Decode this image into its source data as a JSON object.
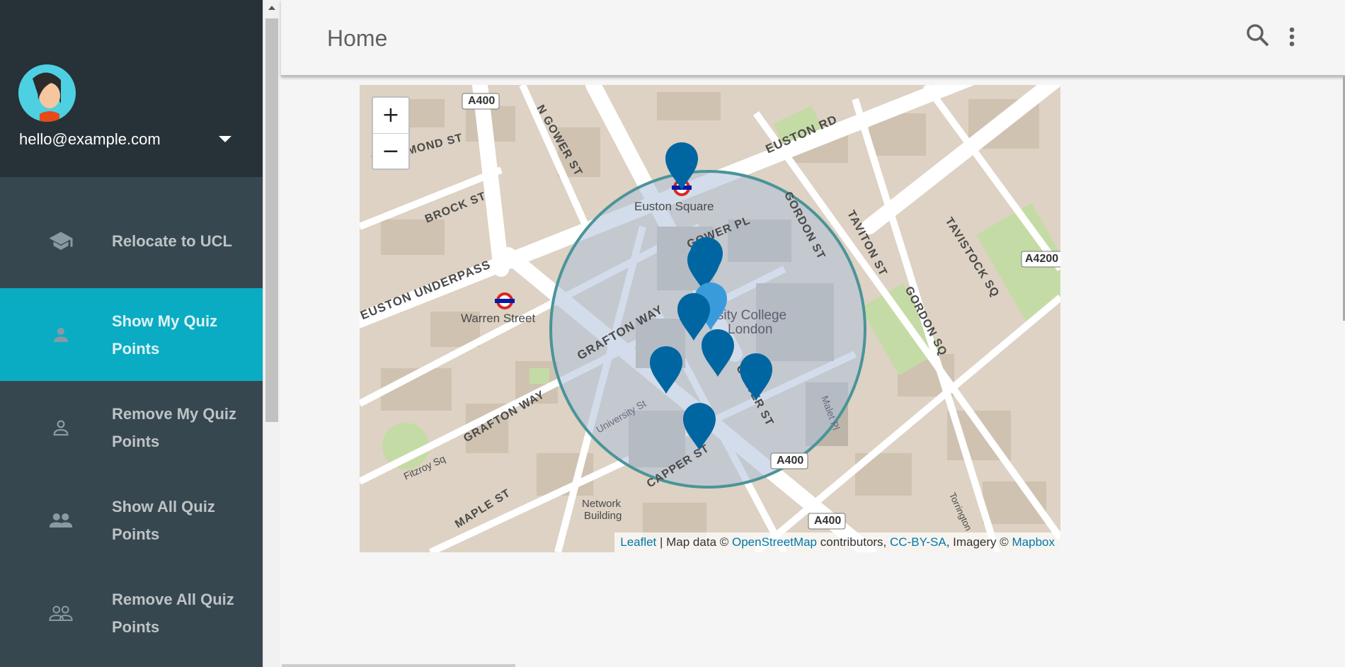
{
  "profile": {
    "email": "hello@example.com"
  },
  "nav": {
    "items": [
      {
        "label": "Relocate to UCL",
        "icon": "school-icon",
        "active": false
      },
      {
        "label": "Show My Quiz Points",
        "icon": "person-icon",
        "active": true
      },
      {
        "label": "Remove My Quiz Points",
        "icon": "person-outline-icon",
        "active": false
      },
      {
        "label": "Show All Quiz Points",
        "icon": "people-icon",
        "active": false
      },
      {
        "label": "Remove All Quiz Points",
        "icon": "people-outline-icon",
        "active": false
      }
    ]
  },
  "header": {
    "title": "Home"
  },
  "map": {
    "zoom_in": "+",
    "zoom_out": "−",
    "labels": {
      "euston_square": "Euston Square",
      "warren_street": "Warren Street",
      "ucl": "University College",
      "ucl2": "London",
      "euston_rd": "EUSTON RD",
      "euston_underpass": "EUSTON UNDERPASS",
      "brock_st": "BROCK ST",
      "grafton_way": "GRAFTON WAY",
      "grafton_way2": "GRAFTON WAY",
      "gower_pl": "GOWER PL",
      "gower_st": "GOWER ST",
      "gordon_st": "GORDON ST",
      "gordon_sq": "GORDON SQ",
      "taviton_st": "TAVITON ST",
      "tavistock_sq": "TAVISTOCK SQ",
      "maple_st": "MAPLE ST",
      "capper_st": "CAPPER ST",
      "university_st": "University St",
      "fitzroy_sq": "Fitzroy Sq",
      "network_building": "Network",
      "network_building2": "Building",
      "n_gower_st": "N GOWER ST",
      "drummond_st": "DRUMMOND ST",
      "malet_pl": "Malet Pl",
      "torrington": "Torrington",
      "a400": "A400",
      "a4200": "A4200"
    },
    "attribution": {
      "leaflet": "Leaflet",
      "sep": " | Map data © ",
      "osm": "OpenStreetMap",
      "contrib": " contributors, ",
      "license": "CC-BY-SA",
      "imagery": ", Imagery © ",
      "mapbox": "Mapbox"
    }
  },
  "colors": {
    "sidebar": "#37474f",
    "profile": "#263238",
    "active": "#0aacc4",
    "marker": "#0066a1",
    "circle": "#4a9499"
  }
}
